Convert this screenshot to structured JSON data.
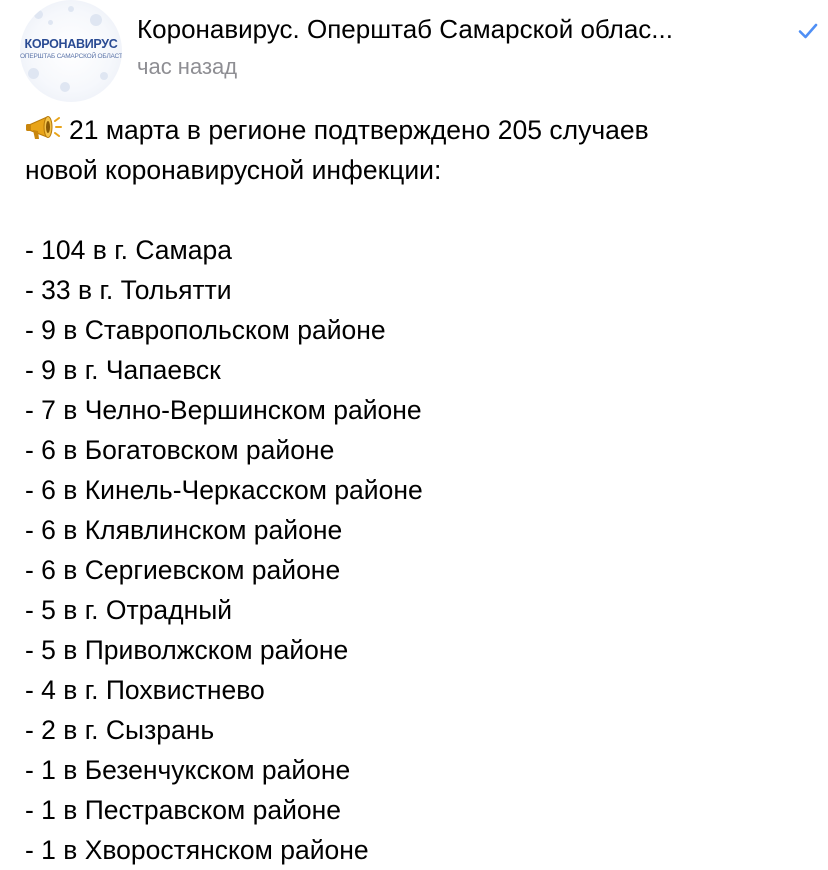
{
  "header": {
    "avatar_title": "КОРОНАВИРУС",
    "avatar_subtitle": "ОПЕРШТАБ САМАРСКОЙ ОБЛАСТИ",
    "channel_name": "Коронавирус. Оперштаб Самарской облас...",
    "verified_icon": "checkmark-icon",
    "timestamp": "час назад"
  },
  "post": {
    "lead_icon": "megaphone-icon",
    "intro_line1": "21 марта в регионе подтверждено 205 случаев",
    "intro_line2": "новой коронавирусной инфекции:",
    "items": [
      "- 104 в г. Самара",
      "- 33 в г. Тольятти",
      "- 9 в Ставропольском районе",
      "- 9 в г. Чапаевск",
      "- 7 в Челно-Вершинском районе",
      "- 6 в Богатовском районе",
      "- 6 в Кинель-Черкасском районе",
      "- 6 в Клявлинском районе",
      "- 6 в Сергиевском районе",
      "- 5 в г. Отрадный",
      "- 5 в Приволжском районе",
      "- 4 в г. Похвистнево",
      "- 2 в г. Сызрань",
      "- 1 в Безенчукском районе",
      "- 1 в Пестравском районе",
      "- 1 в Хворостянском районе"
    ]
  },
  "colors": {
    "text": "#000000",
    "secondary": "#8e8e93",
    "verified": "#4f8ff5",
    "avatar_brand": "#2a4b93"
  }
}
